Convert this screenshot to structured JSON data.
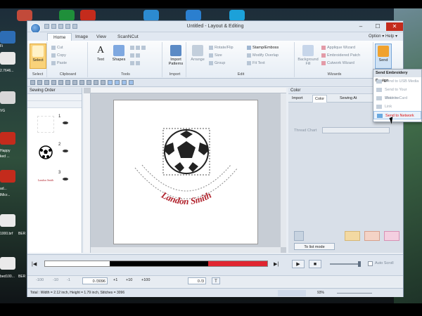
{
  "window": {
    "title": "Untitled - Layout & Editing"
  },
  "ribbon": {
    "tabs": [
      "Home",
      "Image",
      "View",
      "ScanNCut"
    ],
    "help_links": "Option ▾   Help ▾",
    "groups": {
      "select": {
        "label": "Select",
        "button": "Select"
      },
      "clipboard": {
        "label": "Clipboard",
        "items": [
          "Cut",
          "Copy",
          "Paste"
        ]
      },
      "tools": {
        "label": "Tools",
        "buttons": [
          "Text",
          "Shapes"
        ]
      },
      "import": {
        "label": "Import",
        "button": "Import Patterns"
      },
      "edit": {
        "label": "Edit",
        "arrange": "Arrange",
        "items": [
          "Rotate/Flip",
          "Size",
          "Group",
          "Stamp/Emboss",
          "Modify Overlap",
          "Fit Text"
        ]
      },
      "background": {
        "button": "Background Fill"
      },
      "wizards": {
        "label": "Wizards",
        "items": [
          "Applique Wizard",
          "Embroidered Patch",
          "Cutwork Wizard"
        ]
      },
      "send": {
        "button": "Send"
      }
    }
  },
  "send_menu": {
    "title": "Send Embroidery Design",
    "items": [
      "Send to USB Media",
      "Send to Your Machine",
      "Write to Card",
      "Link",
      "Send to Network"
    ]
  },
  "sewing_order": {
    "title": "Sewing Order",
    "items": [
      {
        "num": "1"
      },
      {
        "num": "2"
      },
      {
        "num": "3"
      }
    ]
  },
  "design": {
    "text": "Landon Smith"
  },
  "right_panel": {
    "title": "Color",
    "tabs": [
      "Import",
      "Color",
      "Sewing At"
    ],
    "thread_chart_label": "Thread Chart",
    "to_list_button": "To list mode"
  },
  "playback": {
    "counter": "0 /3096"
  },
  "bottom_controls": {
    "labels": [
      "-100",
      "-10",
      "-1",
      "+1",
      "+10",
      "+100"
    ],
    "counter2": "0 /3",
    "auto_scroll": "Auto Scroll"
  },
  "status": {
    "text": "Total : Width = 2.12 inch, Height = 1.79 inch, Stitches = 3096",
    "zoom": "93%"
  },
  "desktop": {
    "labels": [
      "Fi",
      "2.7646...",
      "VG",
      "Happy",
      "ked ...",
      "Ph",
      "ad...",
      "lMicr...",
      "1000.brf",
      "BER",
      "bed100...",
      "BER",
      "Cl..."
    ]
  },
  "colors": {
    "accent": "#c42b1c",
    "ribbon": "#e6edf5",
    "text_red": "#b0202a"
  }
}
